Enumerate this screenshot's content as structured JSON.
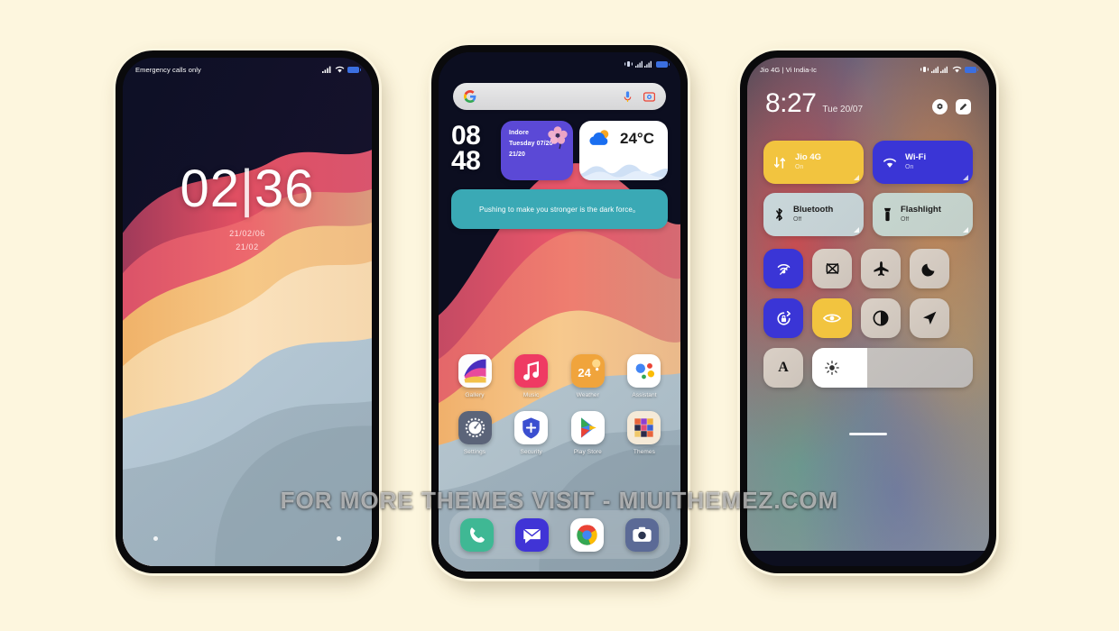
{
  "background_color": "#FDF6DE",
  "watermark": "FOR MORE THEMES VISIT - MIUITHEMEZ.COM",
  "lock_screen": {
    "status_left": "Emergency calls only",
    "status_icons": [
      "signal-icon",
      "wifi-icon",
      "battery-icon"
    ],
    "clock_hours": "02",
    "clock_separator": "|",
    "clock_minutes": "36",
    "date_primary": "21/02/06",
    "date_secondary": "21/02",
    "shortcut_left": "camera-shortcut-dot",
    "shortcut_right": "flashlight-shortcut-dot"
  },
  "home_screen": {
    "status_icons": [
      "vibrate-icon",
      "dual-signal-icon",
      "battery-icon"
    ],
    "search": {
      "placeholder": "",
      "logo": "google-g-icon",
      "mic": "microphone-icon",
      "lens": "google-lens-icon"
    },
    "clock_widget": {
      "hours": "08",
      "minutes": "48"
    },
    "info_widget": {
      "city": "Indore",
      "weekday_date": "Tuesday 07/20",
      "extra": "21/20",
      "decoration": "flower-icon",
      "color": "#5b49d6"
    },
    "weather_widget": {
      "temperature": "24°C",
      "icon": "sun-behind-cloud-icon"
    },
    "quote_widget": {
      "text": "Pushing to make you stronger is the dark force。",
      "color": "#3aa9b5"
    },
    "apps": [
      {
        "label": "Gallery",
        "icon": "gallery-icon"
      },
      {
        "label": "Music",
        "icon": "music-note-icon"
      },
      {
        "label": "Weather",
        "icon": "weather-24-icon"
      },
      {
        "label": "Assistant",
        "icon": "google-assistant-icon"
      },
      {
        "label": "Settings",
        "icon": "settings-gear-icon"
      },
      {
        "label": "Security",
        "icon": "security-shield-icon"
      },
      {
        "label": "Play Store",
        "icon": "play-store-icon"
      },
      {
        "label": "Themes",
        "icon": "themes-grid-icon"
      }
    ],
    "dock": [
      {
        "label": "Phone",
        "icon": "phone-handset-icon"
      },
      {
        "label": "Messages",
        "icon": "message-bubble-icon"
      },
      {
        "label": "Chrome",
        "icon": "chrome-icon"
      },
      {
        "label": "Camera",
        "icon": "camera-icon"
      }
    ]
  },
  "control_center": {
    "carrier": "Jio 4G | Vi India-Ic",
    "status_icons": [
      "vibrate-icon",
      "dual-signal-icon",
      "wifi-icon",
      "battery-icon"
    ],
    "time": "8:27",
    "date": "Tue 20/07",
    "header_buttons": [
      {
        "name": "settings-button",
        "icon": "gear-icon"
      },
      {
        "name": "edit-button",
        "icon": "pencil-icon"
      }
    ],
    "tiles": [
      {
        "title": "Jio 4G",
        "state": "On",
        "icon": "mobile-data-icon",
        "style": "t-yellow"
      },
      {
        "title": "Wi-Fi",
        "state": "On",
        "icon": "wifi-icon",
        "style": "t-blue"
      },
      {
        "title": "Bluetooth",
        "state": "Off",
        "icon": "bluetooth-icon",
        "style": "t-grey1"
      },
      {
        "title": "Flashlight",
        "state": "Off",
        "icon": "flashlight-icon",
        "style": "t-grey2"
      }
    ],
    "toggles_row1": [
      {
        "name": "hotspot-toggle",
        "icon": "hotspot-icon",
        "style": "c-on-blue",
        "active": true
      },
      {
        "name": "screenshot-toggle",
        "icon": "screenshot-icon",
        "style": "c-off",
        "active": false
      },
      {
        "name": "airplane-toggle",
        "icon": "airplane-icon",
        "style": "c-off",
        "active": false
      },
      {
        "name": "dnd-toggle",
        "icon": "moon-icon",
        "style": "c-off",
        "active": false
      }
    ],
    "toggles_row2": [
      {
        "name": "rotation-lock-toggle",
        "icon": "rotation-lock-icon",
        "style": "c-on-blue",
        "active": true
      },
      {
        "name": "reading-mode-toggle",
        "icon": "eye-icon",
        "style": "c-on-yellow",
        "active": true
      },
      {
        "name": "dark-mode-toggle",
        "icon": "contrast-icon",
        "style": "c-off",
        "active": false
      },
      {
        "name": "location-toggle",
        "icon": "location-arrow-icon",
        "style": "c-off2",
        "active": false
      }
    ],
    "auto_brightness": {
      "label": "A",
      "name": "auto-brightness-button"
    },
    "brightness_slider": {
      "icon": "brightness-icon",
      "value": 34
    },
    "home_indicator": "home-indicator-bar"
  }
}
